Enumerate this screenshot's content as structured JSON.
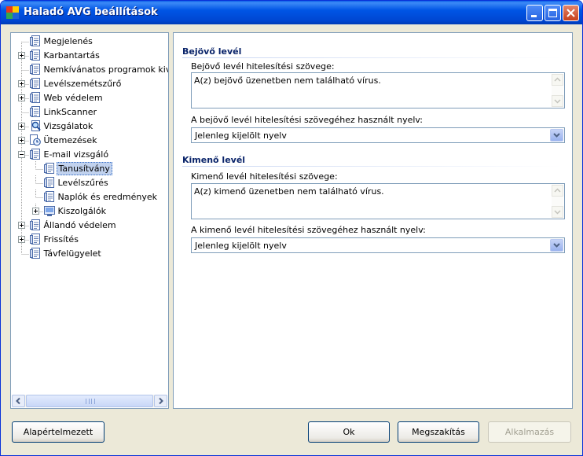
{
  "window": {
    "title": "Haladó AVG beállítások",
    "controls": {
      "minimize": "minimize-icon",
      "maximize": "maximize-icon",
      "close": "close-icon"
    }
  },
  "tree": {
    "items": [
      {
        "label": "Megjelenés",
        "level": 0,
        "expander": "none",
        "icon": "page-icon"
      },
      {
        "label": "Karbantartás",
        "level": 0,
        "expander": "plus",
        "icon": "page-icon"
      },
      {
        "label": "Nemkívánatos programok kivéte",
        "level": 0,
        "expander": "none",
        "icon": "page-icon"
      },
      {
        "label": "Levélszemétszűrő",
        "level": 0,
        "expander": "plus",
        "icon": "page-icon"
      },
      {
        "label": "Web védelem",
        "level": 0,
        "expander": "plus",
        "icon": "page-icon"
      },
      {
        "label": "LinkScanner",
        "level": 0,
        "expander": "none",
        "icon": "page-icon"
      },
      {
        "label": "Vizsgálatok",
        "level": 0,
        "expander": "plus",
        "icon": "magnifier-icon"
      },
      {
        "label": "Ütemezések",
        "level": 0,
        "expander": "plus",
        "icon": "clock-icon"
      },
      {
        "label": "E-mail vizsgáló",
        "level": 0,
        "expander": "minus",
        "icon": "page-icon"
      },
      {
        "label": "Tanusítvány",
        "level": 1,
        "expander": "none",
        "icon": "page-icon",
        "selected": true
      },
      {
        "label": "Levélszűrés",
        "level": 1,
        "expander": "none",
        "icon": "page-icon"
      },
      {
        "label": "Naplók és eredmények",
        "level": 1,
        "expander": "none",
        "icon": "page-icon"
      },
      {
        "label": "Kiszolgálók",
        "level": 1,
        "expander": "plus",
        "icon": "server-icon"
      },
      {
        "label": "Állandó védelem",
        "level": 0,
        "expander": "plus",
        "icon": "page-icon"
      },
      {
        "label": "Frissítés",
        "level": 0,
        "expander": "plus",
        "icon": "page-icon"
      },
      {
        "label": "Távfelügyelet",
        "level": 0,
        "expander": "none",
        "icon": "page-icon"
      }
    ]
  },
  "incoming": {
    "title": "Bejövő levél",
    "text_label": "Bejövő levél hitelesítési szövege:",
    "text_value": "A(z) bejövő üzenetben nem található vírus.",
    "lang_label": "A bejövő levél hitelesítési szövegéhez használt nyelv:",
    "lang_value": "Jelenleg kijelölt nyelv"
  },
  "outgoing": {
    "title": "Kimenő levél",
    "text_label": "Kimenő levél hitelesítési szövege:",
    "text_value": "A(z) kimenő üzenetben nem található vírus.",
    "lang_label": "A kimenő levél hitelesítési szövegéhez használt nyelv:",
    "lang_value": "Jelenleg kijelölt nyelv"
  },
  "buttons": {
    "defaults": "Alapértelmezett",
    "ok": "Ok",
    "cancel": "Megszakítás",
    "apply": "Alkalmazás"
  },
  "colors": {
    "titlebar": "#0055e5",
    "section_title": "#0a246a",
    "selection": "#c1d2ee"
  }
}
